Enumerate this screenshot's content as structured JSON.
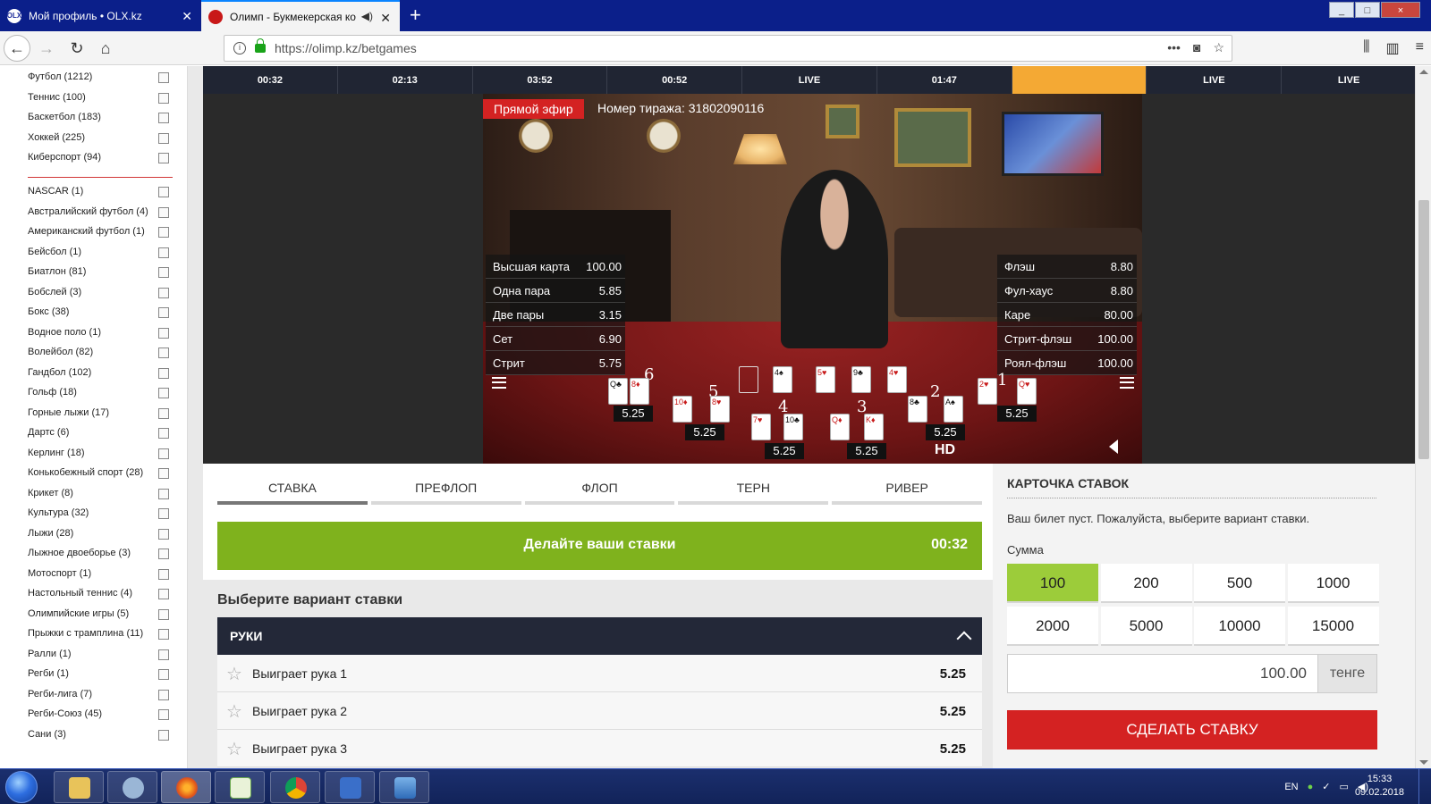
{
  "browser": {
    "tabs": [
      {
        "title": "Мой профиль • OLX.kz",
        "favicon_text": "OLX"
      },
      {
        "title": "Олимп - Букмекерская ко"
      }
    ],
    "url": "https://olimp.kz/betgames",
    "window_controls": [
      "_",
      "□",
      "×"
    ]
  },
  "sidebar": {
    "top_sports": [
      "Футбол (1212)",
      "Теннис (100)",
      "Баскетбол (183)",
      "Хоккей (225)",
      "Киберспорт (94)"
    ],
    "other_sports": [
      "NASCAR (1)",
      "Австралийский футбол (4)",
      "Американский футбол (1)",
      "Бейсбол (1)",
      "Биатлон (81)",
      "Бобслей (3)",
      "Бокс (38)",
      "Водное поло (1)",
      "Волейбол (82)",
      "Гандбол (102)",
      "Гольф (18)",
      "Горные лыжи (17)",
      "Дартс (6)",
      "Керлинг (18)",
      "Конькобежный спорт (28)",
      "Крикет (8)",
      "Культура (32)",
      "Лыжи (28)",
      "Лыжное двоеборье (3)",
      "Мотоспорт (1)",
      "Настольный теннис (4)",
      "Олимпийские игры (5)",
      "Прыжки с трамплина (11)",
      "Ралли (1)",
      "Регби (1)",
      "Регби-лига (7)",
      "Регби-Союз (45)",
      "Сани (3)"
    ]
  },
  "timers": [
    "00:32",
    "02:13",
    "03:52",
    "00:52",
    "LIVE",
    "01:47",
    "",
    "LIVE",
    "LIVE"
  ],
  "video": {
    "live_label": "Прямой эфир",
    "draw_number": "Номер тиража: 31802090116",
    "odds_left": [
      {
        "name": "Высшая карта",
        "odd": "100.00"
      },
      {
        "name": "Одна пара",
        "odd": "5.85"
      },
      {
        "name": "Две пары",
        "odd": "3.15"
      },
      {
        "name": "Сет",
        "odd": "6.90"
      },
      {
        "name": "Стрит",
        "odd": "5.75"
      }
    ],
    "odds_right": [
      {
        "name": "Флэш",
        "odd": "8.80"
      },
      {
        "name": "Фул-хаус",
        "odd": "8.80"
      },
      {
        "name": "Каре",
        "odd": "80.00"
      },
      {
        "name": "Стрит-флэш",
        "odd": "100.00"
      },
      {
        "name": "Роял-флэш",
        "odd": "100.00"
      }
    ],
    "hands": [
      {
        "num": "6",
        "odd": "5.25"
      },
      {
        "num": "5",
        "odd": "5.25"
      },
      {
        "num": "4",
        "odd": "5.25"
      },
      {
        "num": "3",
        "odd": "5.25"
      },
      {
        "num": "2",
        "odd": "5.25"
      },
      {
        "num": "1",
        "odd": "5.25"
      }
    ],
    "hd": "HD"
  },
  "bet_tabs": [
    "СТАВКА",
    "ПРЕФЛОП",
    "ФЛОП",
    "ТЕРН",
    "РИВЕР"
  ],
  "status_bar": {
    "message": "Делайте ваши ставки",
    "time": "00:32"
  },
  "choose": {
    "heading": "Выберите вариант ставки",
    "group": "РУКИ",
    "rows": [
      {
        "name": "Выиграет рука 1",
        "odd": "5.25"
      },
      {
        "name": "Выиграет рука 2",
        "odd": "5.25"
      },
      {
        "name": "Выиграет рука 3",
        "odd": "5.25"
      }
    ]
  },
  "slip": {
    "title": "КАРТОЧКА СТАВОК",
    "empty": "Ваш билет пуст. Пожалуйста, выберите вариант ставки.",
    "sum_label": "Сумма",
    "amounts": [
      "100",
      "200",
      "500",
      "1000",
      "2000",
      "5000",
      "10000",
      "15000"
    ],
    "selected_amount": "100",
    "input_value": "100.00",
    "currency": "тенге",
    "submit": "СДЕЛАТЬ СТАВКУ"
  },
  "taskbar": {
    "lang": "EN",
    "time": "15:33",
    "date": "09.02.2018"
  }
}
